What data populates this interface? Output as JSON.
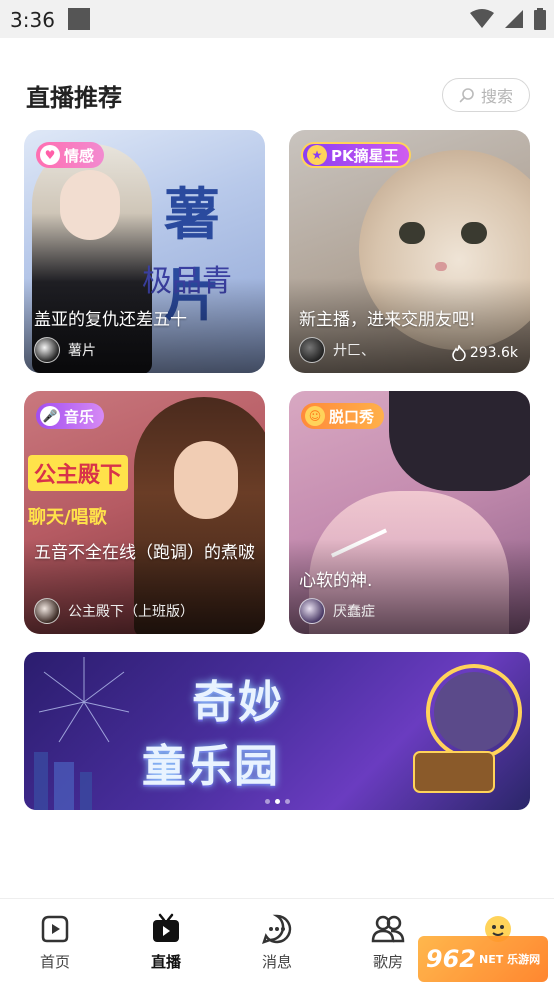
{
  "status_bar": {
    "time": "3:36"
  },
  "header": {
    "title": "直播推荐",
    "search_placeholder": "搜索"
  },
  "cards": [
    {
      "tag": "情感",
      "title": "盖亚的复仇还差五十",
      "host": "薯片",
      "heat": ""
    },
    {
      "tag": "PK摘星王",
      "title": "新主播，进来交朋友吧!",
      "host": "廾匚、",
      "heat": "293.6k"
    },
    {
      "tag": "音乐",
      "title": "五音不全在线（跑调）的煮啵",
      "host": "公主殿下（上班版）",
      "heat": ""
    },
    {
      "tag": "脱口秀",
      "title": "心软的神.",
      "host": "厌蠢症",
      "heat": ""
    }
  ],
  "banner": {
    "line1": "奇妙",
    "line2": "童乐园",
    "page_count": 3,
    "active_page": 1
  },
  "nav": [
    {
      "label": "首页",
      "icon": "home-icon",
      "active": false
    },
    {
      "label": "直播",
      "icon": "live-tv-icon",
      "active": true
    },
    {
      "label": "消息",
      "icon": "message-icon",
      "active": false
    },
    {
      "label": "歌房",
      "icon": "karaoke-room-icon",
      "active": false
    },
    {
      "label": "",
      "icon": "profile-icon",
      "active": false
    }
  ],
  "watermark": {
    "text": "962",
    "sub": "NET 乐游网"
  }
}
